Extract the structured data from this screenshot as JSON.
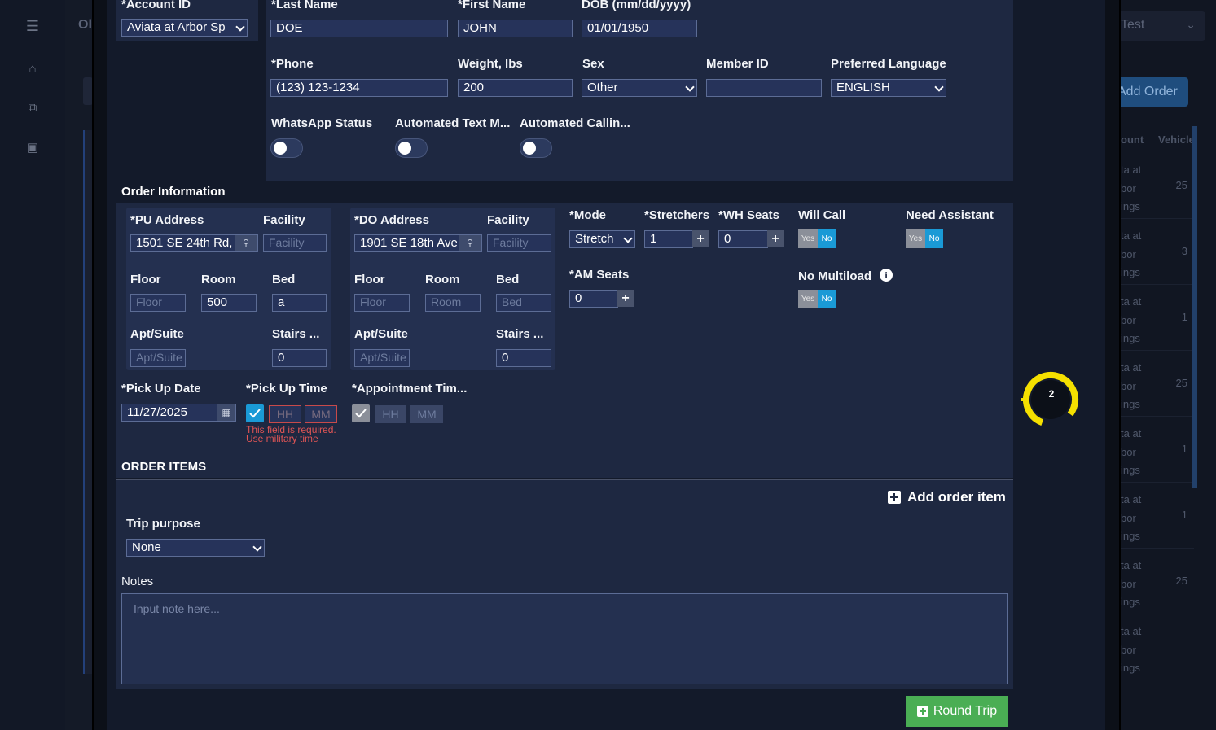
{
  "background": {
    "header_title": "Ol",
    "test_select": "Test",
    "add_order": "Add Order",
    "col_account": "ount",
    "col_vehicle": "Vehicle",
    "rows": [
      {
        "acct": "ta at\nbor\nings",
        "veh": "25"
      },
      {
        "acct": "ta at\nbor\nings",
        "veh": "3"
      },
      {
        "acct": "ta at\nbor\nings",
        "veh": "1"
      },
      {
        "acct": "ta at\nbor\nings",
        "veh": "25"
      },
      {
        "acct": "ta at\nbor\nings",
        "veh": "1"
      },
      {
        "acct": "ta at\nbor\nings",
        "veh": "1"
      },
      {
        "acct": "ta at\nbor\nings",
        "veh": "25"
      },
      {
        "acct": "ta at\nbor\nings",
        "veh": ""
      }
    ]
  },
  "patient": {
    "account_id_label": "*Account ID",
    "account_id_value": "Aviata at Arbor Sp",
    "last_name_label": "*Last Name",
    "last_name_value": "DOE",
    "first_name_label": "*First Name",
    "first_name_value": "JOHN",
    "dob_label": "DOB (mm/dd/yyyy)",
    "dob_value": "01/01/1950",
    "phone_label": "*Phone",
    "phone_value": "(123) 123-1234",
    "weight_label": "Weight, lbs",
    "weight_value": "200",
    "sex_label": "Sex",
    "sex_value": "Other",
    "member_id_label": "Member ID",
    "member_id_value": "",
    "language_label": "Preferred Language",
    "language_value": "ENGLISH",
    "whatsapp_label": "WhatsApp Status",
    "auto_text_label": "Automated Text M...",
    "auto_call_label": "Automated Callin..."
  },
  "order": {
    "section_title": "Order Information",
    "pu": {
      "address_label": "*PU Address",
      "address_value": "1501 SE 24th Rd,",
      "facility_label": "Facility",
      "facility_placeholder": "Facility",
      "floor_label": "Floor",
      "floor_placeholder": "Floor",
      "room_label": "Room",
      "room_value": "500",
      "bed_label": "Bed",
      "bed_value": "a",
      "apt_label": "Apt/Suite",
      "apt_placeholder": "Apt/Suite",
      "stairs_label": "Stairs ...",
      "stairs_value": "0"
    },
    "do": {
      "address_label": "*DO Address",
      "address_value": "1901 SE 18th Ave",
      "facility_label": "Facility",
      "facility_placeholder": "Facility",
      "floor_label": "Floor",
      "floor_placeholder": "Floor",
      "room_label": "Room",
      "room_placeholder": "Room",
      "bed_label": "Bed",
      "bed_placeholder": "Bed",
      "apt_label": "Apt/Suite",
      "apt_placeholder": "Apt/Suite",
      "stairs_label": "Stairs ...",
      "stairs_value": "0"
    },
    "mode_label": "*Mode",
    "mode_value": "Stretch",
    "stretchers_label": "*Stretchers",
    "stretchers_value": "1",
    "wh_seats_label": "*WH Seats",
    "wh_seats_value": "0",
    "am_seats_label": "*AM Seats",
    "am_seats_value": "0",
    "will_call_label": "Will Call",
    "need_assistant_label": "Need Assistant",
    "no_multiload_label": "No Multiload",
    "yes": "Yes",
    "no": "No",
    "info_glyph": "i",
    "pickup_date_label": "*Pick Up Date",
    "pickup_date_value": "11/27/2025",
    "pickup_time_label": "*Pick Up Time",
    "hh": "HH",
    "mm": "MM",
    "error_line1": "This field is required.",
    "error_line2": "Use military time",
    "appt_time_label": "*Appointment Tim..."
  },
  "items": {
    "section_title": "ORDER ITEMS",
    "add_item": "Add order item",
    "trip_purpose_label": "Trip purpose",
    "trip_purpose_value": "None",
    "notes_label": "Notes",
    "notes_placeholder": "Input note here..."
  },
  "footer": {
    "round_trip": "Round Trip"
  },
  "cursor": {
    "step": "2"
  },
  "colors": {
    "accent_green": "#4aae54",
    "toggle_blue": "#1a9ad6",
    "cursor_yellow": "#f5e000",
    "error_red": "#e05555"
  }
}
